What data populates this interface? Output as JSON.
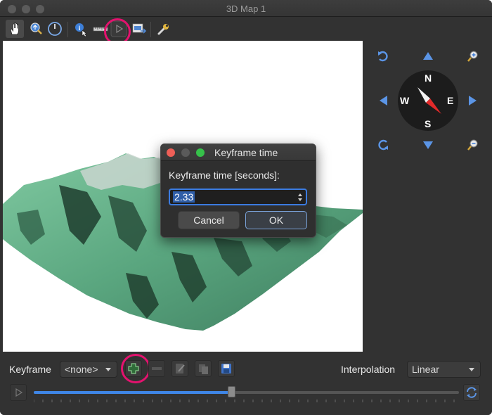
{
  "window": {
    "title": "3D Map 1"
  },
  "toolbar": {
    "icons": [
      "pan-hand-icon",
      "zoom-extent-icon",
      "camera-orbit-icon",
      "identify-icon",
      "measure-icon",
      "animation-play-icon",
      "export-icon",
      "options-wrench-icon"
    ]
  },
  "navigation": {
    "compass": {
      "north": "N",
      "south": "S",
      "east": "E",
      "west": "W"
    }
  },
  "dialog": {
    "title": "Keyframe time",
    "label": "Keyframe time [seconds]:",
    "value": "2.33",
    "cancel_label": "Cancel",
    "ok_label": "OK"
  },
  "animation": {
    "keyframe_label": "Keyframe",
    "keyframe_selected": "<none>",
    "interpolation_label": "Interpolation",
    "interpolation_selected": "Linear",
    "timeline_progress": 0.465
  },
  "colors": {
    "accent": "#3b7be0",
    "highlight_ring": "#e3126e",
    "terrain": "#5aa67f"
  }
}
